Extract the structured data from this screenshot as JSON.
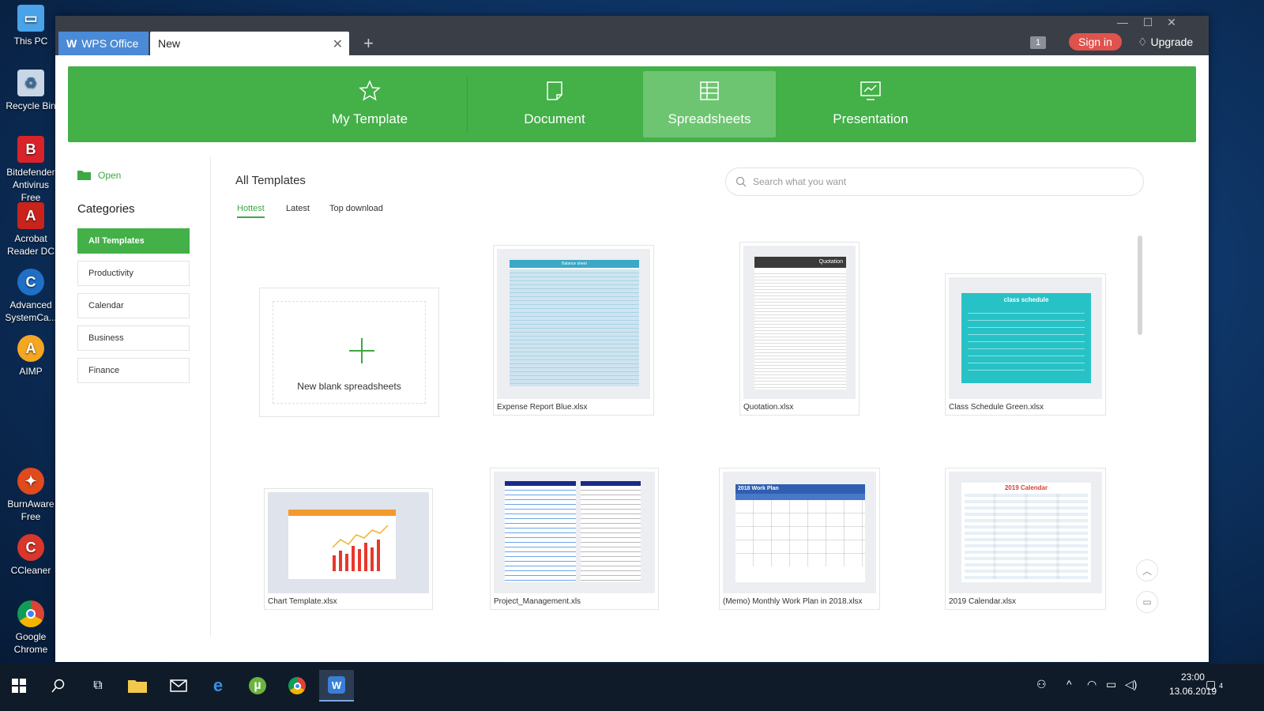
{
  "desktop": {
    "icons": [
      {
        "label": "This PC",
        "icon": "computer-icon",
        "color": "#4aa3e8"
      },
      {
        "label": "Recycle Bin",
        "icon": "recycle-bin-icon",
        "color": "#c8d6e6"
      },
      {
        "label": "Bitdefender Antivirus Free",
        "icon": "bitdefender-icon",
        "color": "#d8232a"
      },
      {
        "label": "Acrobat Reader DC",
        "icon": "acrobat-icon",
        "color": "#c9231b"
      },
      {
        "label": "Advanced SystemCa...",
        "icon": "advanced-systemcare-icon",
        "color": "#1f6fc5"
      },
      {
        "label": "AIMP",
        "icon": "aimp-icon",
        "color": "#f5a623"
      },
      {
        "label": "BurnAware Free",
        "icon": "burnaware-icon",
        "color": "#e04a1d"
      },
      {
        "label": "CCleaner",
        "icon": "ccleaner-icon",
        "color": "#d9372b"
      },
      {
        "label": "Google Chrome",
        "icon": "chrome-icon",
        "color": "#2e9e48"
      }
    ]
  },
  "titlebar": {
    "app_tab": "WPS Office",
    "doc_tab": "New",
    "badge": "1",
    "sign_in": "Sign in",
    "upgrade": "Upgrade"
  },
  "header_tabs": [
    {
      "label": "My Template",
      "icon": "star-icon"
    },
    {
      "label": "Document",
      "icon": "document-icon"
    },
    {
      "label": "Spreadsheets",
      "icon": "spreadsheet-icon"
    },
    {
      "label": "Presentation",
      "icon": "presentation-icon"
    }
  ],
  "active_header_tab": "Spreadsheets",
  "sidebar": {
    "open_label": "Open",
    "categories_title": "Categories",
    "categories": [
      "All Templates",
      "Productivity",
      "Calendar",
      "Business",
      "Finance"
    ],
    "active_category": "All Templates"
  },
  "main": {
    "title": "All Templates",
    "filter_tabs": [
      "Hottest",
      "Latest",
      "Top download"
    ],
    "active_filter": "Hottest",
    "search_placeholder": "Search what you want",
    "blank_label": "New blank spreadsheets",
    "templates": [
      {
        "name": "Expense Report Blue.xlsx",
        "thumb_title": "Balance sheet"
      },
      {
        "name": "Quotation.xlsx",
        "thumb_title": "Quotation"
      },
      {
        "name": "Class Schedule Green.xlsx",
        "thumb_title": "class schedule"
      },
      {
        "name": "Chart Template.xlsx"
      },
      {
        "name": "Project_Management.xls"
      },
      {
        "name": "(Memo) Monthly Work Plan in 2018.xlsx",
        "thumb_title": "2018  Work Plan"
      },
      {
        "name": "2019 Calendar.xlsx",
        "thumb_title": "2019 Calendar"
      }
    ]
  },
  "colors": {
    "green": "#43b048",
    "green_active": "#6dc571",
    "titlebar": "#3a3f47",
    "signin": "#e0524c"
  },
  "taskbar": {
    "time": "23:00",
    "date": "13.06.2019",
    "notification_count": "4"
  }
}
